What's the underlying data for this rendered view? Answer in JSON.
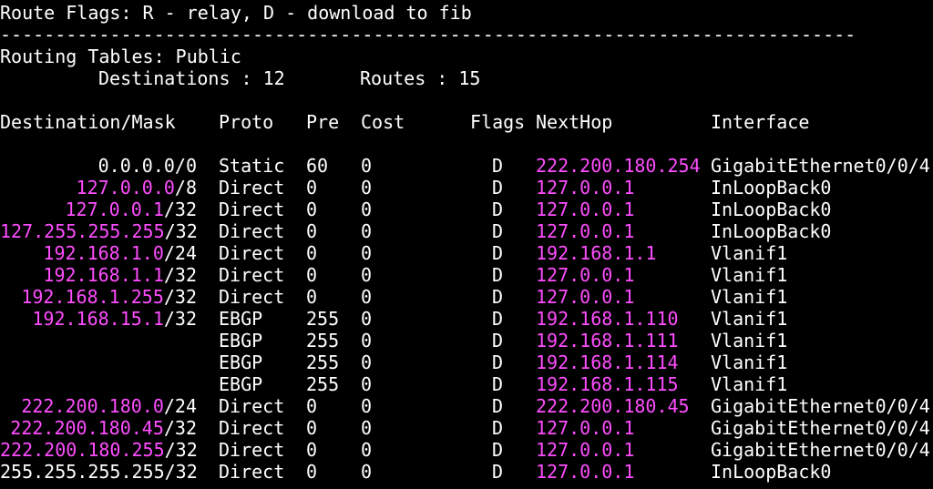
{
  "header": {
    "cut_line": "Route Flags: R - relay, D - download to fib",
    "route_flags": "Route Flags: R - relay, D - download to fib",
    "separator": "------------------------------------------------------------------------------",
    "routing_tables_label": "Routing Tables: Public",
    "destinations_label": "Destinations : 12",
    "routes_label": "Routes : 15"
  },
  "columns": {
    "destination_mask": "Destination/Mask",
    "proto": "Proto",
    "pre": "Pre",
    "cost": "Cost",
    "flags": "Flags",
    "nexthop": "NextHop",
    "interface": "Interface"
  },
  "routes": [
    {
      "dest": "0.0.0.0",
      "mask": "/0",
      "proto": "Static",
      "pre": "60",
      "cost": "0",
      "flags": "D",
      "nexthop": "222.200.180.254",
      "interface": "GigabitEthernet0/0/4"
    },
    {
      "dest": "127.0.0.0",
      "mask": "/8",
      "proto": "Direct",
      "pre": "0",
      "cost": "0",
      "flags": "D",
      "nexthop": "127.0.0.1",
      "interface": "InLoopBack0"
    },
    {
      "dest": "127.0.0.1",
      "mask": "/32",
      "proto": "Direct",
      "pre": "0",
      "cost": "0",
      "flags": "D",
      "nexthop": "127.0.0.1",
      "interface": "InLoopBack0"
    },
    {
      "dest": "127.255.255.255",
      "mask": "/32",
      "proto": "Direct",
      "pre": "0",
      "cost": "0",
      "flags": "D",
      "nexthop": "127.0.0.1",
      "interface": "InLoopBack0"
    },
    {
      "dest": "192.168.1.0",
      "mask": "/24",
      "proto": "Direct",
      "pre": "0",
      "cost": "0",
      "flags": "D",
      "nexthop": "192.168.1.1",
      "interface": "Vlanif1"
    },
    {
      "dest": "192.168.1.1",
      "mask": "/32",
      "proto": "Direct",
      "pre": "0",
      "cost": "0",
      "flags": "D",
      "nexthop": "127.0.0.1",
      "interface": "Vlanif1"
    },
    {
      "dest": "192.168.1.255",
      "mask": "/32",
      "proto": "Direct",
      "pre": "0",
      "cost": "0",
      "flags": "D",
      "nexthop": "127.0.0.1",
      "interface": "Vlanif1"
    },
    {
      "dest": "192.168.15.1",
      "mask": "/32",
      "proto": "EBGP",
      "pre": "255",
      "cost": "0",
      "flags": "D",
      "nexthop": "192.168.1.110",
      "interface": "Vlanif1"
    },
    {
      "dest": "",
      "mask": "",
      "proto": "EBGP",
      "pre": "255",
      "cost": "0",
      "flags": "D",
      "nexthop": "192.168.1.111",
      "interface": "Vlanif1"
    },
    {
      "dest": "",
      "mask": "",
      "proto": "EBGP",
      "pre": "255",
      "cost": "0",
      "flags": "D",
      "nexthop": "192.168.1.114",
      "interface": "Vlanif1"
    },
    {
      "dest": "",
      "mask": "",
      "proto": "EBGP",
      "pre": "255",
      "cost": "0",
      "flags": "D",
      "nexthop": "192.168.1.115",
      "interface": "Vlanif1"
    },
    {
      "dest": "222.200.180.0",
      "mask": "/24",
      "proto": "Direct",
      "pre": "0",
      "cost": "0",
      "flags": "D",
      "nexthop": "222.200.180.45",
      "interface": "GigabitEthernet0/0/4"
    },
    {
      "dest": "222.200.180.45",
      "mask": "/32",
      "proto": "Direct",
      "pre": "0",
      "cost": "0",
      "flags": "D",
      "nexthop": "127.0.0.1",
      "interface": "GigabitEthernet0/0/4"
    },
    {
      "dest": "222.200.180.255",
      "mask": "/32",
      "proto": "Direct",
      "pre": "0",
      "cost": "0",
      "flags": "D",
      "nexthop": "127.0.0.1",
      "interface": "GigabitEthernet0/0/4"
    },
    {
      "dest": "255.255.255.255",
      "mask": "/32",
      "proto": "Direct",
      "pre": "0",
      "cost": "0",
      "flags": "D",
      "nexthop": "127.0.0.1",
      "interface": "InLoopBack0"
    }
  ],
  "colors": {
    "background": "#000000",
    "text": "#ffffff",
    "ip_highlight": "#ff4dff"
  }
}
